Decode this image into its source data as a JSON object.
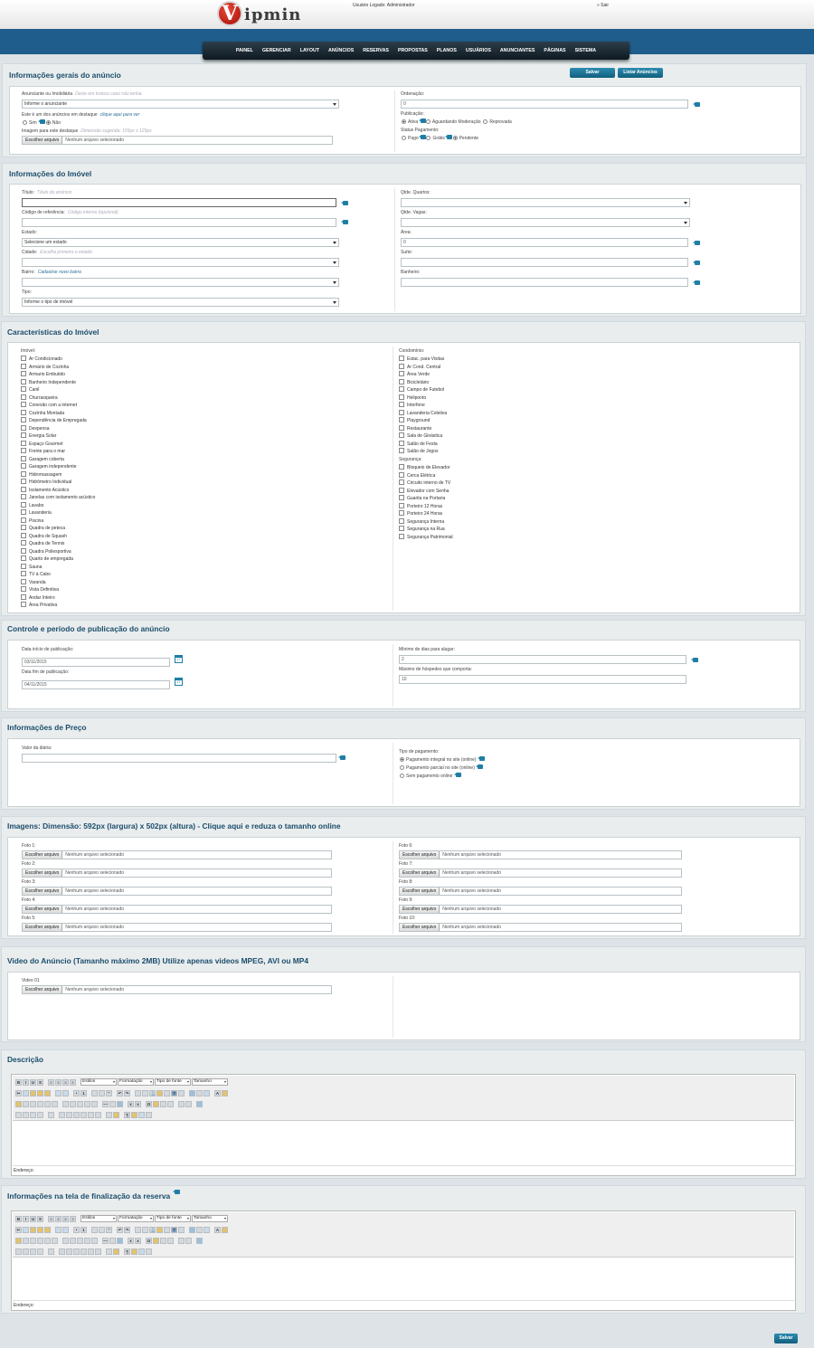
{
  "header": {
    "logo_letter": "V",
    "logo_rest": "ipmin",
    "user_logged": "Usuário Logado: Administrador",
    "logout": "» Sair"
  },
  "nav": [
    "PAINEL",
    "GERENCIAR",
    "LAYOUT",
    "ANÚNCIOS",
    "RESERVAS",
    "PROPOSTAS",
    "PLANOS",
    "USUÁRIOS",
    "ANUNCIANTES",
    "PÁGINAS",
    "SISTEMA"
  ],
  "general": {
    "title": "Informações gerais do anúncio",
    "save": "Salvar",
    "list": "Listar Anúncios",
    "advertiser_label": "Anunciante ou Imobiliária",
    "advertiser_hint": "Deixe em branco caso não tenha",
    "advertiser_value": "Informe o anunciante",
    "featured_label": "Este é um dos anúncios em destaque",
    "featured_link": "clique aqui para ver",
    "yes": "Sim",
    "no": "Não",
    "image_label": "Imagem para este destaque",
    "image_hint": "Dimensão sugerida: 155px x 125px",
    "order_label": "Ordenação:",
    "order_value": "0",
    "pub_label": "Publicação:",
    "pub_active": "Ativa",
    "pub_waiting": "Aguardando Moderação",
    "pub_rejected": "Reprovada",
    "pay_label": "Status Pagamento:",
    "pay_paid": "Pago",
    "pay_free": "Grátis",
    "pay_pending": "Pendente"
  },
  "file": {
    "button": "Escolher arquivo",
    "none": "Nenhum arquivo selecionado"
  },
  "property": {
    "title": "Informações do Imóvel",
    "titulo_label": "Título:",
    "titulo_hint": "Título do anúncio",
    "ref_label": "Código de referência:",
    "ref_hint": "Código interno (opcional)",
    "estado_label": "Estado:",
    "estado_value": "Selecione um estado",
    "cidade_label": "Cidade:",
    "cidade_hint": "Escolha primeiro o estado",
    "bairro_label": "Bairro:",
    "bairro_link": "Cadastrar novo bairro",
    "tipo_label": "Tipo:",
    "tipo_value": "Informe o tipo de imóvel",
    "quartos_label": "Qtde. Quartos:",
    "vagas_label": "Qtde. Vagas:",
    "area_label": "Área:",
    "area_value": "0",
    "suite_label": "Suíte:",
    "banheiro_label": "Banheiro:"
  },
  "features": {
    "title": "Características do Imóvel",
    "imovel_label": "Imóvel:",
    "imovel": [
      "Ar Condicionado",
      "Armário de Cozinha",
      "Armario Embutido",
      "Banheiro Independente",
      "Canil",
      "Churrasqueira",
      "Conexão com a internet",
      "Cozinha Montada",
      "Dependência de Empregada",
      "Despensa",
      "Energia Solar",
      "Espaço Gourmet",
      "Frente para o mar",
      "Garagem coberta",
      "Garagem independente",
      "Hidromassagem",
      "Hidrômetro Individual",
      "Isolamento Acústico",
      "Janelas com isolamento acústico",
      "Lavabo",
      "Lavanderia",
      "Piscina",
      "Quadra de peteca",
      "Quadra de Squash",
      "Quadra de Tennis",
      "Quadra Poliesportiva",
      "Quarto de empregada",
      "Sauna",
      "TV à Cabo",
      "Varanda",
      "Vista Definitiva",
      "Andar Inteiro",
      "Área Privativa"
    ],
    "condominio_label": "Condomínio:",
    "condominio": [
      "Estac. para Visitas",
      "Ar Cond. Central",
      "Área Verde",
      "Bicicletário",
      "Campo de Futebol",
      "Heliponto",
      "Interfone",
      "Lavanderia Coletiva",
      "Playground",
      "Restaurante",
      "Sala de Ginástica",
      "Salão de Festa",
      "Salão de Jogos"
    ],
    "seguranca_label": "Segurança:",
    "seguranca": [
      "Bloqueio de Elevador",
      "Cerca Elétrica",
      "Circuito interno de TV",
      "Elevador com Senha",
      "Guarita na Portaria",
      "Porteiro 12 Horas",
      "Porteiro 24 Horas",
      "Segurança Interna",
      "Segurança na Rua",
      "Segurança Patrimonial"
    ]
  },
  "control": {
    "title": "Controle e período de publicação do anúncio",
    "start_label": "Data início de publicação:",
    "start_value": "03/11/2015",
    "end_label": "Data fim de publicação:",
    "end_value": "04/11/2015",
    "cal_num": "17",
    "min_label": "Mínimo de dias para alugar:",
    "min_value": "2",
    "max_label": "Máximo de hóspedes que comporta:",
    "max_value": "10"
  },
  "price": {
    "title": "Informações de Preço",
    "daily_label": "Valor da diária:",
    "paytype_label": "Tipo de pagamento:",
    "opt1": "Pagamento integral no site (online)",
    "opt2": "Pagamento parcial no site (online)",
    "opt3": "Sem pagamento online"
  },
  "images": {
    "title": "Imagens: Dimensão: 592px (largura) x 502px (altura) - Clique aqui e reduza o tamanho online",
    "left": [
      "Foto 1:",
      "Foto 2:",
      "Foto 3:",
      "Foto 4:",
      "Foto 5:"
    ],
    "right": [
      "Foto 6:",
      "Foto 7:",
      "Foto 8:",
      "Foto 9:",
      "Foto 10:"
    ]
  },
  "video": {
    "title": "Video do Anúncio (Tamanho máximo 2MB) Utilize apenas videos MPEG, AVI ou MP4",
    "label": "Video 01"
  },
  "editor": {
    "styles": "Estilos",
    "format": "Formatação",
    "font": "Tipo de fonte",
    "size": "Tamanho",
    "path": "Endereço:",
    "omega": "Ω"
  },
  "description": {
    "title": "Descrição"
  },
  "final": {
    "title": "Informações na tela de finalização da reserva"
  },
  "footer": {
    "save": "Salvar"
  },
  "colors": {
    "brand_blue": "#1f5d8c",
    "accent_teal": "#1e7ea6",
    "logo_red": "#c41a0d"
  }
}
